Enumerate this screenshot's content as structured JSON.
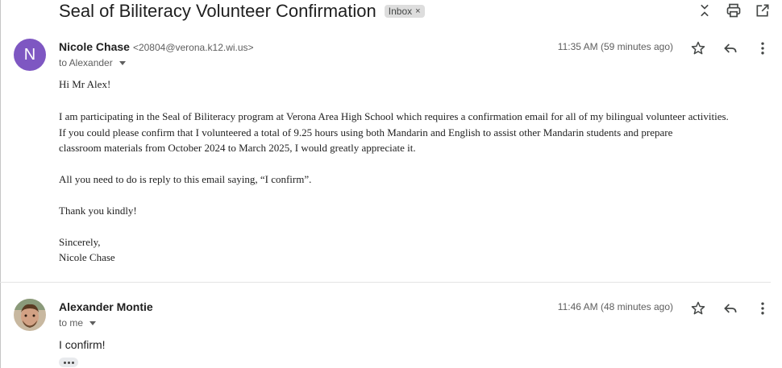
{
  "header": {
    "subject": "Seal of Biliteracy Volunteer Confirmation",
    "label": "Inbox",
    "label_close": "×"
  },
  "messages": [
    {
      "avatar_letter": "N",
      "avatar_color": "#7e57c2",
      "sender_name": "Nicole Chase",
      "sender_email": "<20804@verona.k12.wi.us>",
      "recipient": "to Alexander",
      "time": "11:35 AM (59 minutes ago)",
      "body": {
        "greeting": "Hi Mr Alex!",
        "para1_line1": "I am participating in the Seal of Biliteracy program at Verona Area High School which requires a confirmation email for all of my bilingual volunteer activities.",
        "para1_line2": "If you could please confirm that I volunteered a total of 9.25 hours using both Mandarin and English to assist other Mandarin students and prepare",
        "para1_line3": "classroom materials from October 2024 to March 2025, I would greatly appreciate it.",
        "para2": "All you need to do is reply to this email saying, “I confirm”.",
        "para3": "Thank you kindly!",
        "closing": "Sincerely,",
        "signature": "Nicole Chase"
      }
    },
    {
      "sender_name": "Alexander Montie",
      "recipient": "to me",
      "time": "11:46 AM (48 minutes ago)",
      "body_text": "I confirm!"
    }
  ],
  "icons": {
    "collapse": "collapse-all-icon",
    "print": "print-icon",
    "popout": "open-in-new-window-icon",
    "star": "star-icon",
    "reply": "reply-icon",
    "more": "more-vert-icon"
  }
}
